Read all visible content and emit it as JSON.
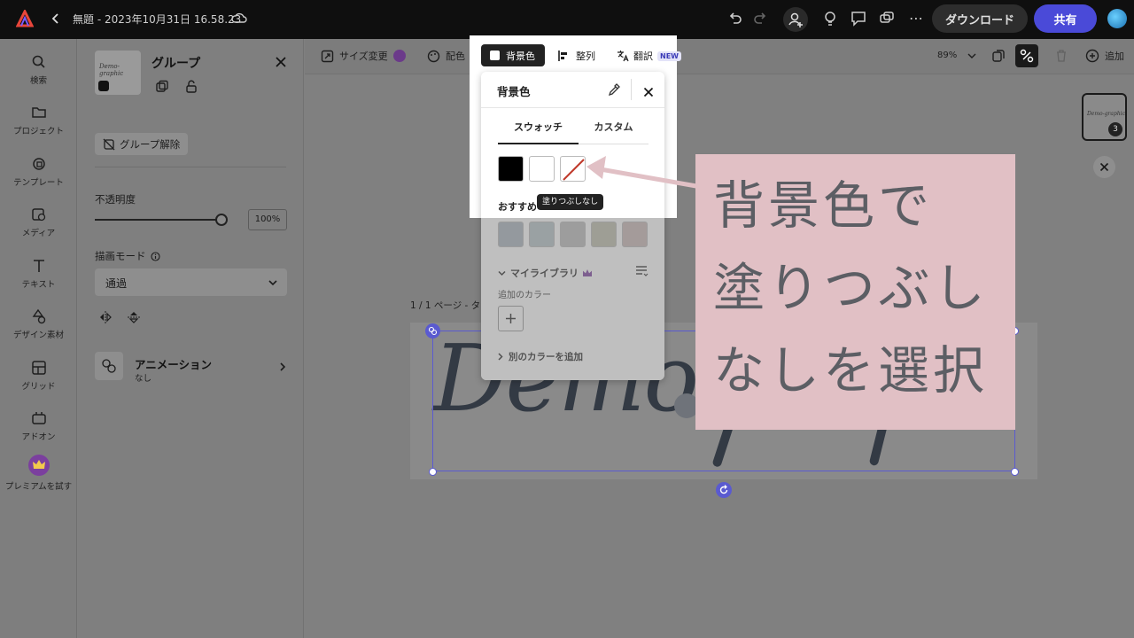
{
  "app": {
    "title": "無題 - 2023年10月31日 16.58.23"
  },
  "topbar": {
    "download_label": "ダウンロード",
    "share_label": "共有"
  },
  "rail": {
    "items": [
      {
        "label": "検索",
        "icon": "search-icon"
      },
      {
        "label": "プロジェクト",
        "icon": "folder-icon"
      },
      {
        "label": "テンプレート",
        "icon": "template-icon"
      },
      {
        "label": "メディア",
        "icon": "media-icon"
      },
      {
        "label": "テキスト",
        "icon": "text-icon"
      },
      {
        "label": "デザイン素材",
        "icon": "shapes-icon"
      },
      {
        "label": "グリッド",
        "icon": "grid-icon"
      },
      {
        "label": "アドオン",
        "icon": "addon-icon"
      },
      {
        "label": "プレミアムを試す",
        "icon": "crown-icon"
      }
    ]
  },
  "panel": {
    "title": "グループ",
    "thumb_text": "Demo-graphic",
    "ungroup_label": "グループ解除",
    "opacity_label": "不透明度",
    "opacity_value": "100%",
    "opacity_fraction": 1.0,
    "blend_label": "描画モード",
    "blend_value": "通過",
    "animation_label": "アニメーション",
    "animation_value": "なし"
  },
  "toolbar": {
    "resize_label": "サイズ変更",
    "color_label": "配色",
    "bg_label": "背景色",
    "align_label": "整列",
    "translate_label": "翻訳",
    "new_badge": "NEW",
    "zoom": "89%",
    "add_label": "追加"
  },
  "popover": {
    "title": "背景色",
    "tab_swatch": "スウォッチ",
    "tab_custom": "カスタム",
    "swatches": [
      "#000000",
      "#ffffff"
    ],
    "tooltip": "塗りつぶしなし",
    "recommended_label": "おすすめ",
    "recommended": [
      "#a9b3bd",
      "#b5c3c6",
      "#bbbbbb",
      "#bcbcaa",
      "#c8b7b5"
    ],
    "library_label": "マイライブラリ",
    "added_colors_label": "追加のカラー",
    "add_other_label": "別のカラーを追加"
  },
  "canvas": {
    "page_label": "1 / 1 ページ - タ",
    "artwork_text": "Demo",
    "page_count": "3",
    "thumb_text": "Demo-graphic"
  },
  "annotation": {
    "lines": [
      "背景色で",
      "塗りつぶし",
      "なしを選択"
    ]
  },
  "colors": {
    "accent": "#4a4ad8",
    "annotation_bg": "#e1c0c5",
    "annotation_text": "#5c5e64"
  }
}
